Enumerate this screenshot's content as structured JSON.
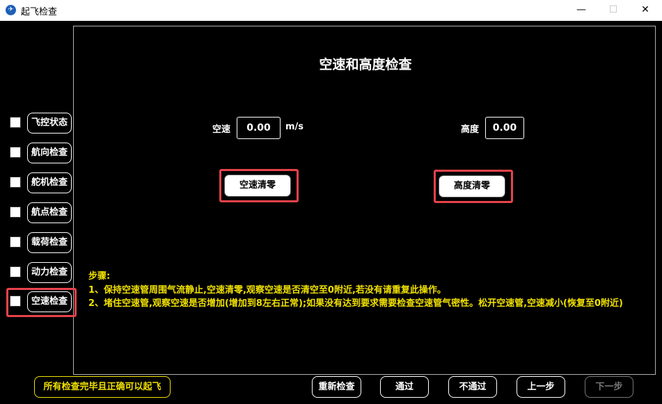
{
  "window": {
    "title": "起飞检查",
    "controls": {
      "minimize": "—",
      "maximize": "☐",
      "close": "✕"
    }
  },
  "sidebar": {
    "items": [
      {
        "label": "飞控状态",
        "checked": false
      },
      {
        "label": "航向检查",
        "checked": false
      },
      {
        "label": "舵机检查",
        "checked": false
      },
      {
        "label": "航点检查",
        "checked": false
      },
      {
        "label": "载荷检查",
        "checked": false
      },
      {
        "label": "动力检查",
        "checked": false
      },
      {
        "label": "空速检查",
        "checked": false,
        "highlighted": true
      }
    ]
  },
  "main": {
    "heading": "空速和高度检查",
    "airspeed": {
      "label": "空速",
      "value": "0.00",
      "unit": "m/s",
      "zero_button": "空速清零"
    },
    "altitude": {
      "label": "高度",
      "value": "0.00",
      "zero_button": "高度清零"
    },
    "steps": {
      "title": "步骤:",
      "line1": "1、保持空速管周围气流静止,空速清零,观察空速是否清空至0附近,若没有请重复此操作。",
      "line2": "2、堵住空速管,观察空速是否增加(增加到8左右正常);如果没有达到要求需要检查空速管气密性。松开空速管,空速减小(恢复至0附近)"
    }
  },
  "footer": {
    "notice": "所有检查完毕且正确可以起飞",
    "recheck": "重新检查",
    "pass": "通过",
    "fail": "不通过",
    "prev": "上一步",
    "next": "下一步"
  },
  "colors": {
    "background": "#000000",
    "highlight": "#e8424a",
    "instruction_text": "#f0e000"
  }
}
